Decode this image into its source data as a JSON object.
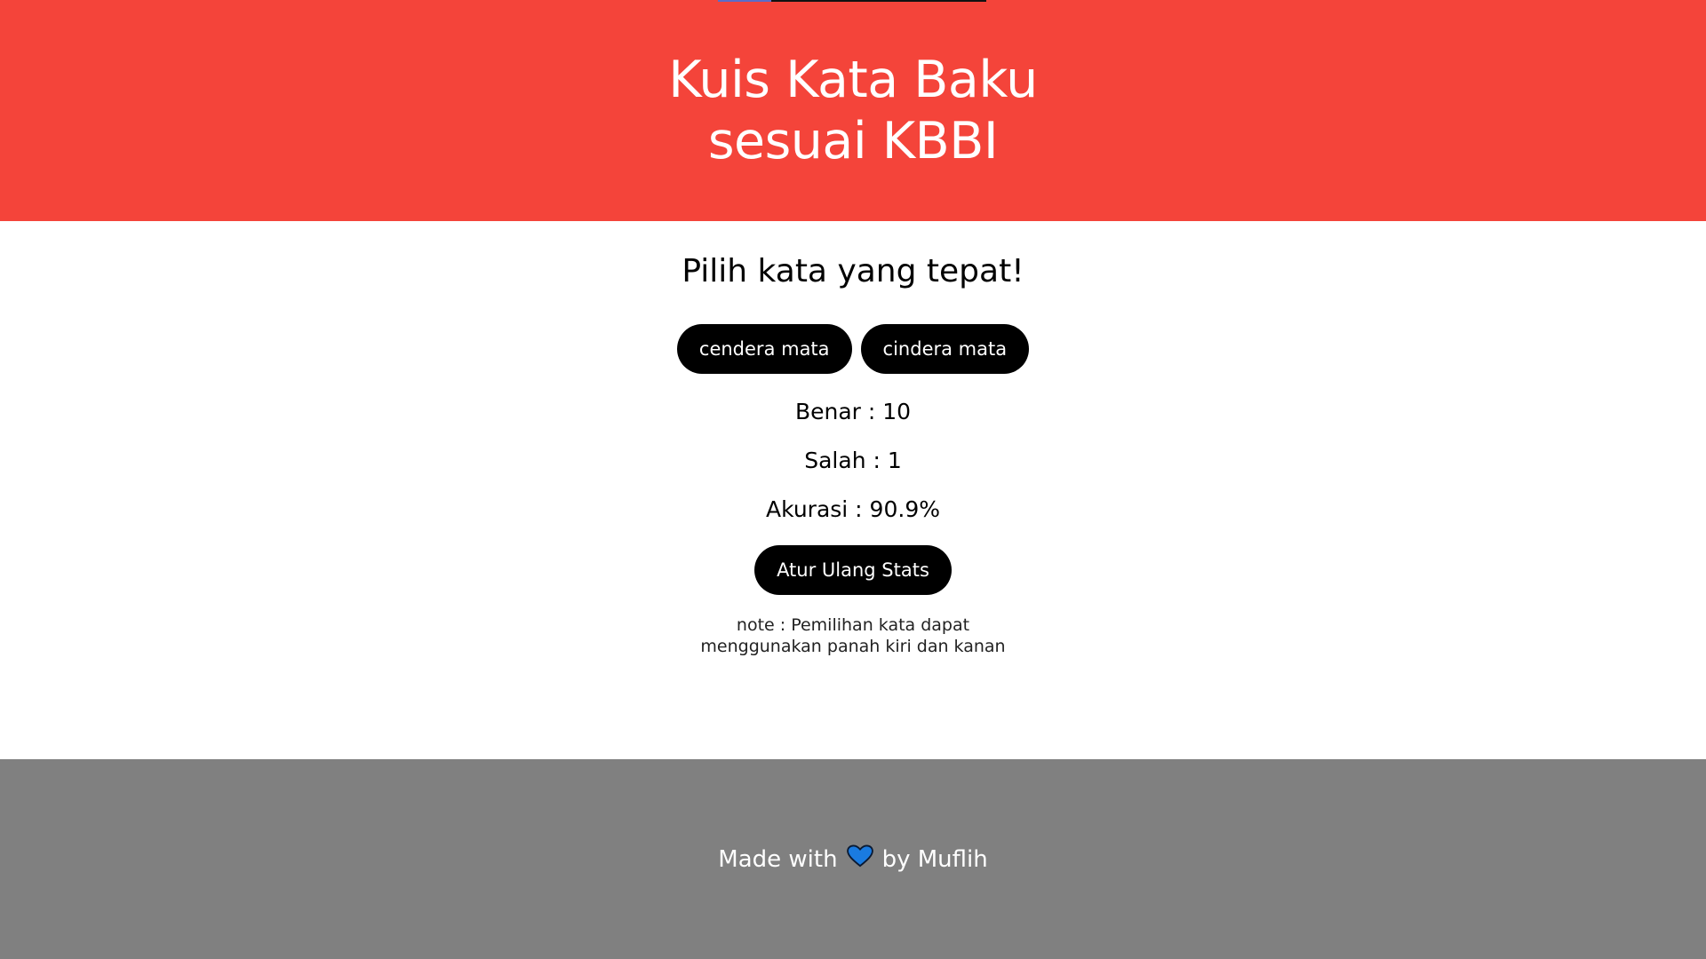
{
  "header": {
    "title_line1": "Kuis Kata Baku",
    "title_line2": "sesuai KBBI",
    "background": "#f4443a",
    "progress_fraction": 0.2
  },
  "quiz": {
    "prompt": "Pilih kata yang tepat!",
    "options": [
      "cendera mata",
      "cindera mata"
    ]
  },
  "stats": {
    "correct_label": "Benar : 10",
    "wrong_label": "Salah : 1",
    "accuracy_label": "Akurasi : 90.9%",
    "reset_label": "Atur Ulang Stats"
  },
  "note": "note : Pemilihan kata dapat menggunakan panah kiri dan kanan",
  "footer": {
    "made_with": "Made with",
    "by": "by Muflih",
    "heart_icon": "blue-heart-icon",
    "heart_color": "#1a7be0",
    "background": "#808080"
  }
}
